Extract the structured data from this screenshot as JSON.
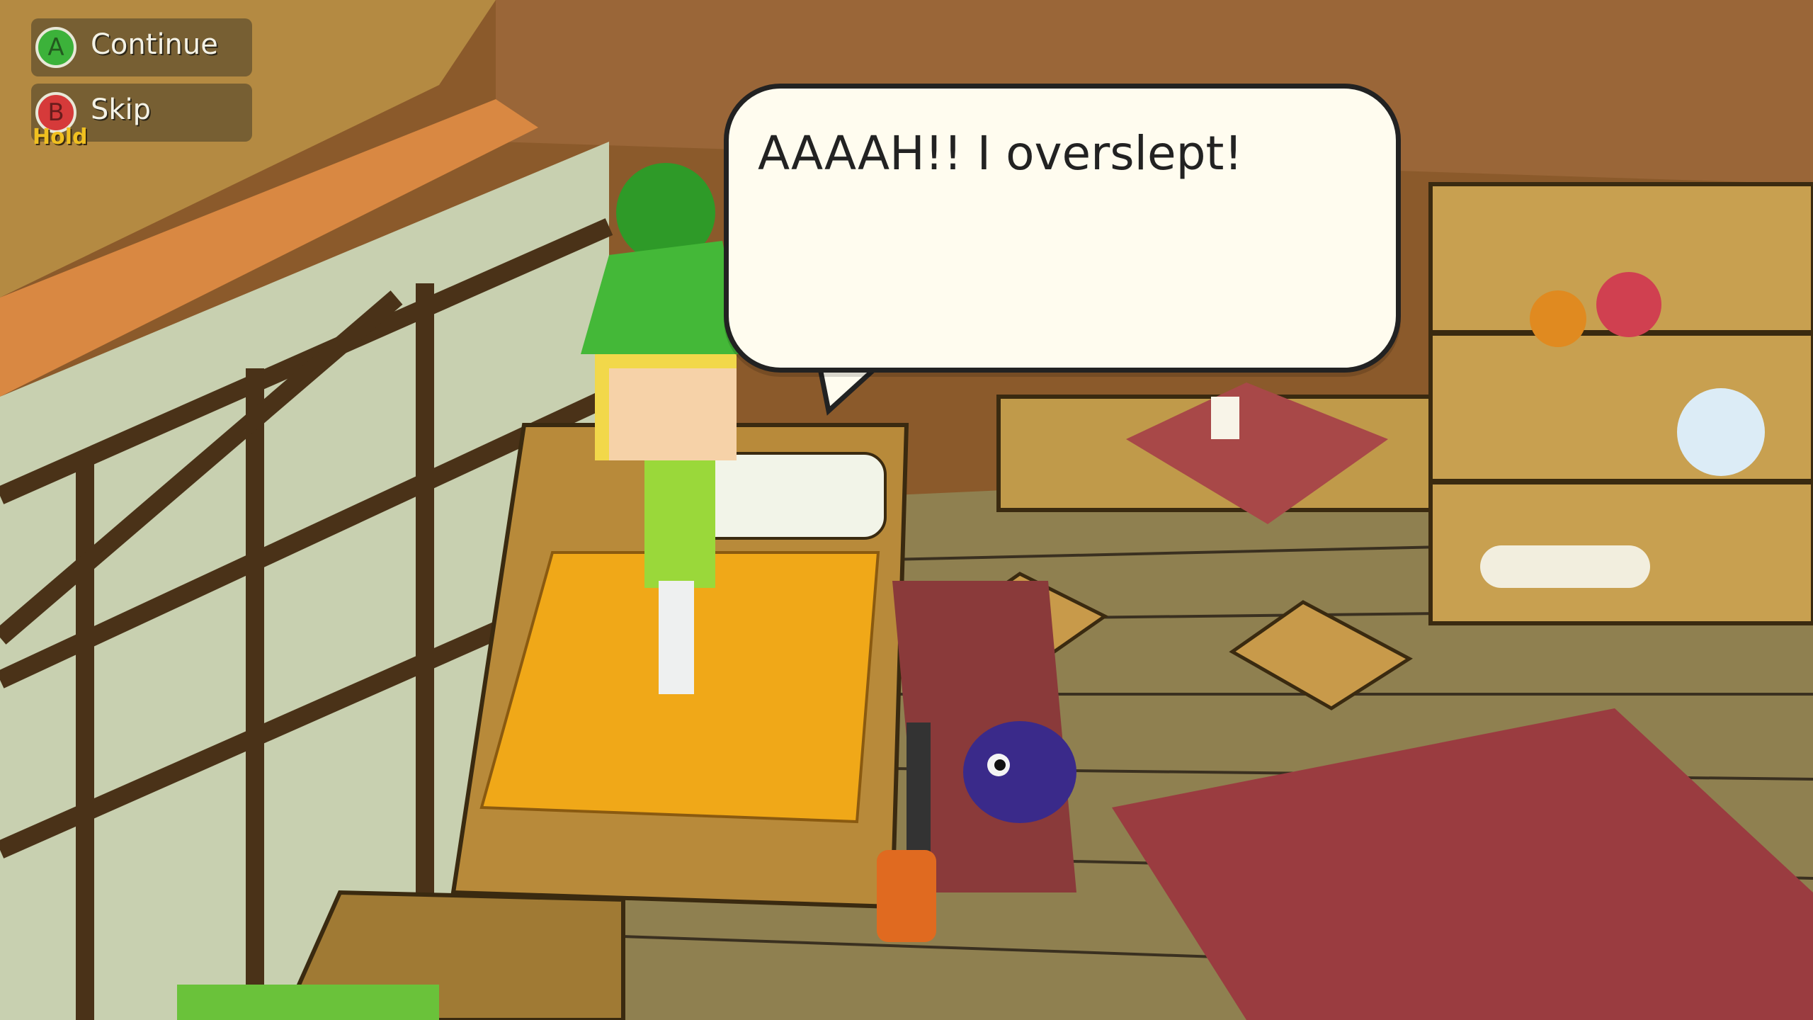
{
  "hud": {
    "continue": {
      "button": "A",
      "label": "Continue"
    },
    "skip": {
      "button": "B",
      "label": "Skip",
      "modifier": "Hold"
    }
  },
  "dialogue": {
    "text": "AAAAH!! I overslept!"
  },
  "colors": {
    "button_a": "#3cb23a",
    "button_b": "#d63a3a",
    "hold_text": "#f0c020",
    "bubble_fill": "#fffcef",
    "bubble_outline": "#222222"
  }
}
